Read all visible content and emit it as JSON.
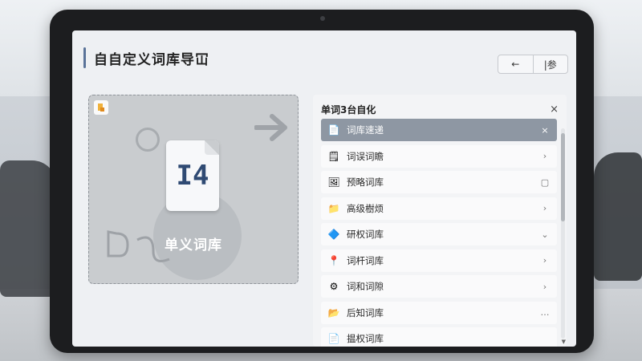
{
  "header": {
    "title": "自自定义词库导冚",
    "nav_back": "←",
    "nav_other": "|参"
  },
  "drop_zone": {
    "file_glyph": "I4",
    "label": "单义词库"
  },
  "list_panel": {
    "title": "单词3台自化",
    "close": "×",
    "items": [
      {
        "label": "词库速递",
        "icon": "document-icon",
        "icon_glyph": "📄",
        "trail": "×",
        "active": true
      },
      {
        "label": "词误词瞻",
        "icon": "file-text-icon",
        "icon_glyph": "🗒",
        "trail": "›",
        "active": false
      },
      {
        "label": "预略词库",
        "icon": "presentation-icon",
        "icon_glyph": "🖼",
        "trail": "▢",
        "active": false
      },
      {
        "label": "高级樹烦",
        "icon": "folder-icon",
        "icon_glyph": "📁",
        "trail": "›",
        "active": false
      },
      {
        "label": "研权词库",
        "icon": "shapes-icon",
        "icon_glyph": "🔷",
        "trail": "⌄",
        "active": false
      },
      {
        "label": "词杆词库",
        "icon": "pin-icon",
        "icon_glyph": "📍",
        "trail": "›",
        "active": false
      },
      {
        "label": "词和词隙",
        "icon": "gear-icon",
        "icon_glyph": "⚙",
        "trail": "›",
        "active": false
      },
      {
        "label": "后知词库",
        "icon": "open-folder-icon",
        "icon_glyph": "📂",
        "trail": "…",
        "active": false
      },
      {
        "label": "揾权词库",
        "icon": "document-icon",
        "icon_glyph": "📄",
        "trail": "",
        "active": false
      }
    ]
  },
  "colors": {
    "accent": "#5a7399",
    "active_row": "#8e97a3"
  }
}
